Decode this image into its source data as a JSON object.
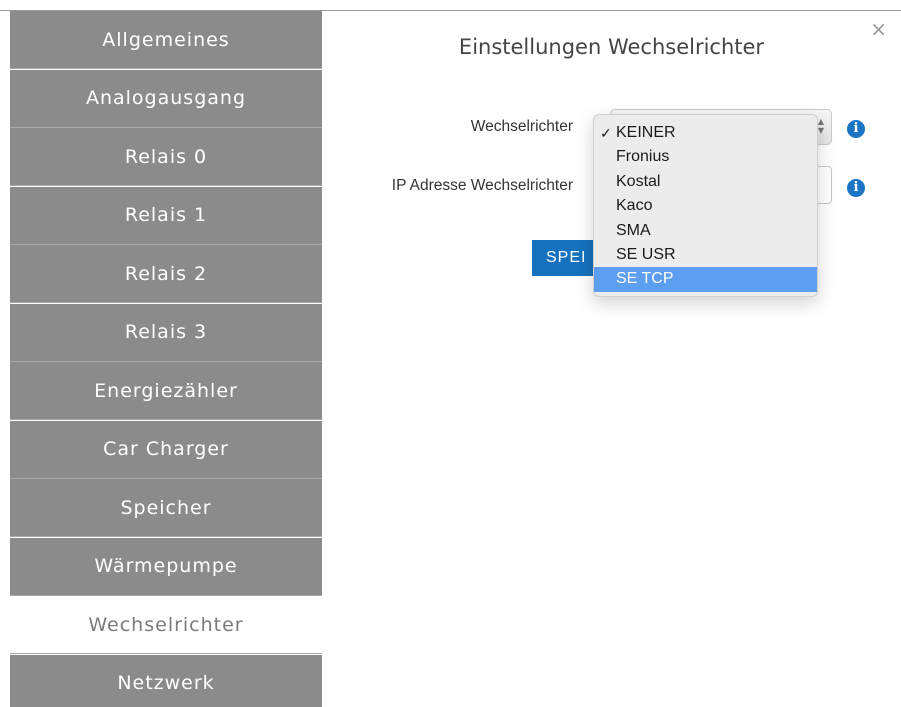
{
  "sidebar": {
    "items": [
      {
        "label": "Allgemeines"
      },
      {
        "label": "Analogausgang"
      },
      {
        "label": "Relais 0"
      },
      {
        "label": "Relais 1"
      },
      {
        "label": "Relais 2"
      },
      {
        "label": "Relais 3"
      },
      {
        "label": "Energiezähler"
      },
      {
        "label": "Car Charger"
      },
      {
        "label": "Speicher"
      },
      {
        "label": "Wärmepumpe"
      },
      {
        "label": "Wechselrichter",
        "active": true
      },
      {
        "label": "Netzwerk"
      }
    ]
  },
  "dialog": {
    "title": "Einstellungen Wechselrichter",
    "close_label": "×",
    "inverter_label": "Wechselrichter",
    "ip_label": "IP Adresse Wechselrichter",
    "ip_value": "",
    "save_label": "SPEI",
    "info_glyph": "i"
  },
  "dropdown": {
    "selected": "KEINER",
    "highlighted": "SE TCP",
    "checkmark": "✓",
    "options": [
      "KEINER",
      "Fronius",
      "Kostal",
      "Kaco",
      "SMA",
      "SE USR",
      "SE TCP"
    ]
  },
  "icons": {
    "close": "close-icon",
    "info": "info-icon",
    "select_arrows": "chevron-up-down-icon",
    "check": "checkmark-icon"
  },
  "colors": {
    "sidebar_bg": "#8b8b8b",
    "sidebar_active_bg": "#ffffff",
    "accent": "#1672be",
    "highlight": "#5c9ef0"
  }
}
